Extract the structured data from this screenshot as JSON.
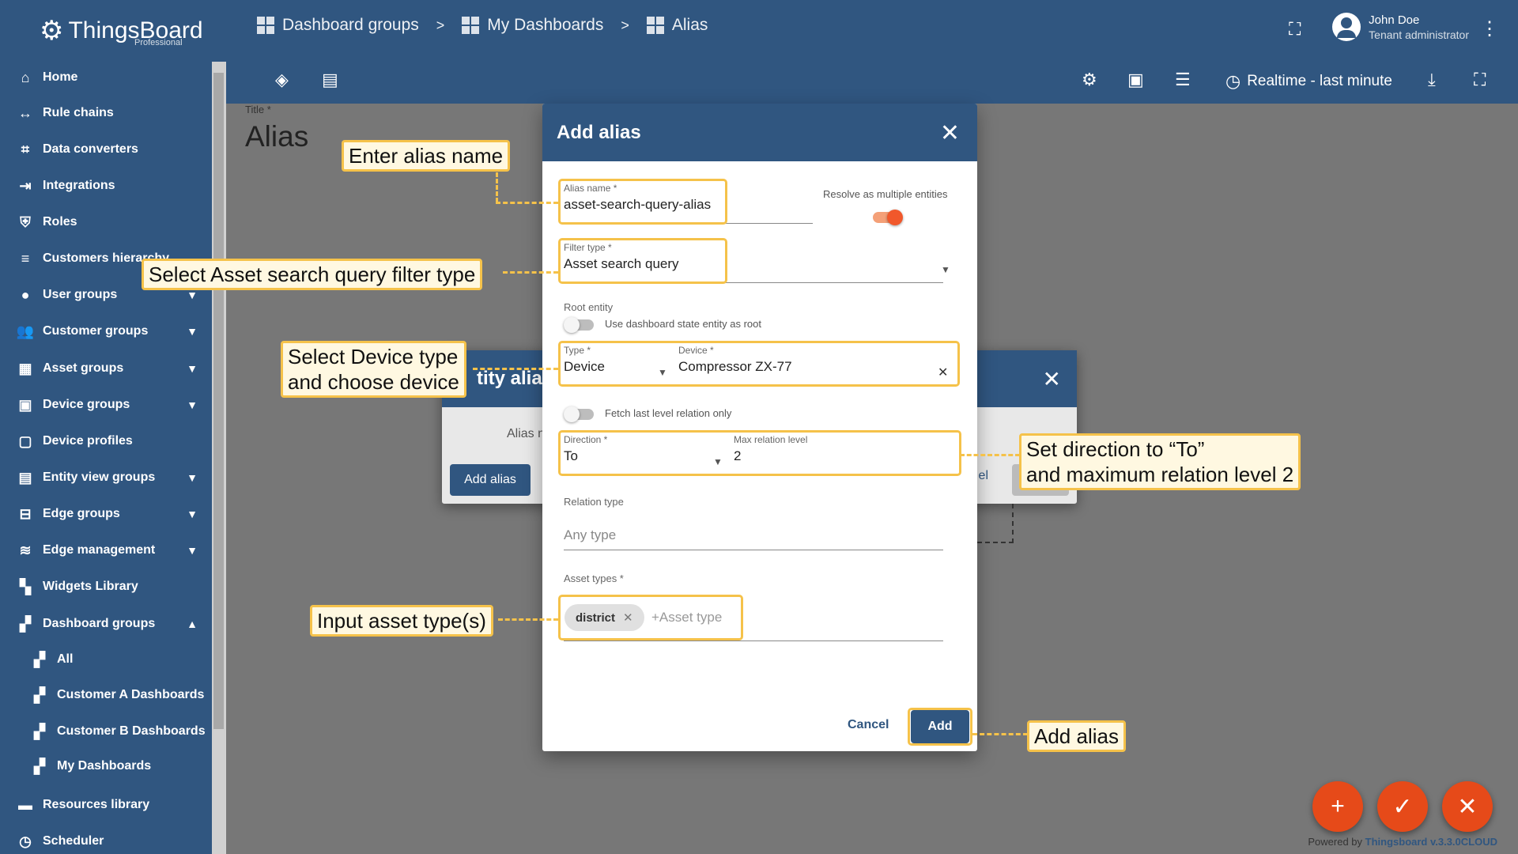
{
  "app": {
    "logo": "ThingsBoard",
    "edition": "Professional"
  },
  "breadcrumb": [
    {
      "label": "Dashboard groups"
    },
    {
      "label": "My Dashboards"
    },
    {
      "label": "Alias"
    }
  ],
  "breadcrumb_sep": ">",
  "user": {
    "name": "John Doe",
    "role": "Tenant administrator"
  },
  "toolbar": {
    "timewindow": "Realtime - last minute"
  },
  "sidebar": {
    "items": [
      {
        "label": "Home",
        "icon": "home-icon"
      },
      {
        "label": "Rule chains",
        "icon": "rule-chain-icon"
      },
      {
        "label": "Data converters",
        "icon": "converter-icon"
      },
      {
        "label": "Integrations",
        "icon": "integration-icon"
      },
      {
        "label": "Roles",
        "icon": "shield-icon"
      },
      {
        "label": "Customers hierarchy",
        "icon": "hierarchy-icon"
      },
      {
        "label": "User groups",
        "icon": "account-icon"
      },
      {
        "label": "Customer groups",
        "icon": "group-icon"
      },
      {
        "label": "Asset groups",
        "icon": "building-icon"
      },
      {
        "label": "Device groups",
        "icon": "devices-icon"
      },
      {
        "label": "Device profiles",
        "icon": "device-profile-icon"
      },
      {
        "label": "Entity view groups",
        "icon": "view-icon"
      },
      {
        "label": "Edge groups",
        "icon": "router-icon"
      },
      {
        "label": "Edge management",
        "icon": "wifi-icon"
      },
      {
        "label": "Widgets Library",
        "icon": "widgets-icon"
      },
      {
        "label": "Dashboard groups",
        "icon": "dashboard-icon"
      },
      {
        "label": "All",
        "icon": "dashboard-icon"
      },
      {
        "label": "Customer A Dashboards",
        "icon": "dashboard-icon"
      },
      {
        "label": "Customer B Dashboards",
        "icon": "dashboard-icon"
      },
      {
        "label": "My Dashboards",
        "icon": "dashboard-icon"
      },
      {
        "label": "Resources library",
        "icon": "folder-icon"
      },
      {
        "label": "Scheduler",
        "icon": "clock-icon"
      }
    ]
  },
  "page": {
    "title_label": "Title *",
    "title": "Alias"
  },
  "back_dialog": {
    "title_fragment": "tity alias",
    "alias_label": "Alias n",
    "add_alias": "Add alias",
    "cancel_fragment": "el"
  },
  "dialog": {
    "title": "Add alias",
    "alias_name_label": "Alias name *",
    "alias_name_value": "asset-search-query-alias",
    "resolve_multiple_label": "Resolve as multiple entities",
    "filter_type_label": "Filter type *",
    "filter_type_value": "Asset search query",
    "root_entity_label": "Root entity",
    "use_state_entity_label": "Use dashboard state entity as root",
    "type_label": "Type *",
    "type_value": "Device",
    "device_label": "Device *",
    "device_value": "Compressor ZX-77",
    "fetch_last_level_label": "Fetch last level relation only",
    "direction_label": "Direction *",
    "direction_value": "To",
    "max_level_label": "Max relation level",
    "max_level_value": "2",
    "relation_type_label": "Relation type",
    "relation_type_placeholder": "Any type",
    "asset_types_label": "Asset types *",
    "asset_type_chip": "district",
    "asset_type_placeholder": "+Asset type",
    "cancel": "Cancel",
    "add": "Add"
  },
  "callouts": {
    "alias_name": "Enter alias name",
    "filter_type": "Select Asset search query filter type",
    "device_line1": "Select Device type",
    "device_line2": "and choose device",
    "direction_line1": "Set direction to “To”",
    "direction_line2": "and maximum relation level 2",
    "asset_types": "Input asset type(s)",
    "add_alias": "Add alias"
  },
  "footer": {
    "powered_prefix": "Powered by",
    "powered_brand": "Thingsboard v.3.3.0CLOUD"
  },
  "colors": {
    "primary": "#305680",
    "accent": "#e64a19",
    "highlight": "#f5c24a"
  }
}
